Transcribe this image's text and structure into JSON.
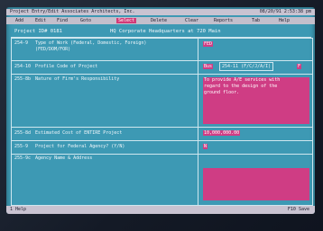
{
  "title_bar": {
    "left": "Project Entry/Edit  Associates Architects, Inc.",
    "right": "08/20/91  2:53:38 pm"
  },
  "menu": [
    "Add",
    "Edit",
    "Find",
    "Goto",
    "Select",
    "Delete",
    "Clear",
    "Reports",
    "Tab",
    "Help"
  ],
  "menu_active": "Select",
  "project": {
    "label": "Project ID# 0181",
    "name": "HQ Corporate Headquarters at 720 Main"
  },
  "fields": [
    {
      "code": "254-9",
      "label": "Type of Work (Federal, Domestic, Foreign)\n(FED/DOM/FOR)",
      "value": "FED"
    },
    {
      "code": "254-10",
      "label": "Profile Code of Project",
      "value": "Bus",
      "side_label": "254-11 (F/C/J/A/I)",
      "side_value": "F"
    },
    {
      "code": "255-8b",
      "label": "Nature of Firm's Responsibility",
      "value": "To provide A/E services with\nregard to the design of the\nground floor."
    },
    {
      "code": "255-8d",
      "label": "Estimated Cost of ENTIRE Project",
      "value": "10,000,000.00"
    },
    {
      "code": "255-9",
      "label": "Project for Federal Agency? (Y/N)",
      "value": "N"
    },
    {
      "code": "255-9c",
      "label": "Agency Name & Address",
      "value": ""
    }
  ],
  "status_bar": {
    "left": "1 Help",
    "right": "F10 Save"
  },
  "colors": {
    "screen": "#3d99b4",
    "field_highlight": "#cf3d84",
    "menu_bar": "#c9c3d1",
    "text": "#f2f7fb"
  }
}
